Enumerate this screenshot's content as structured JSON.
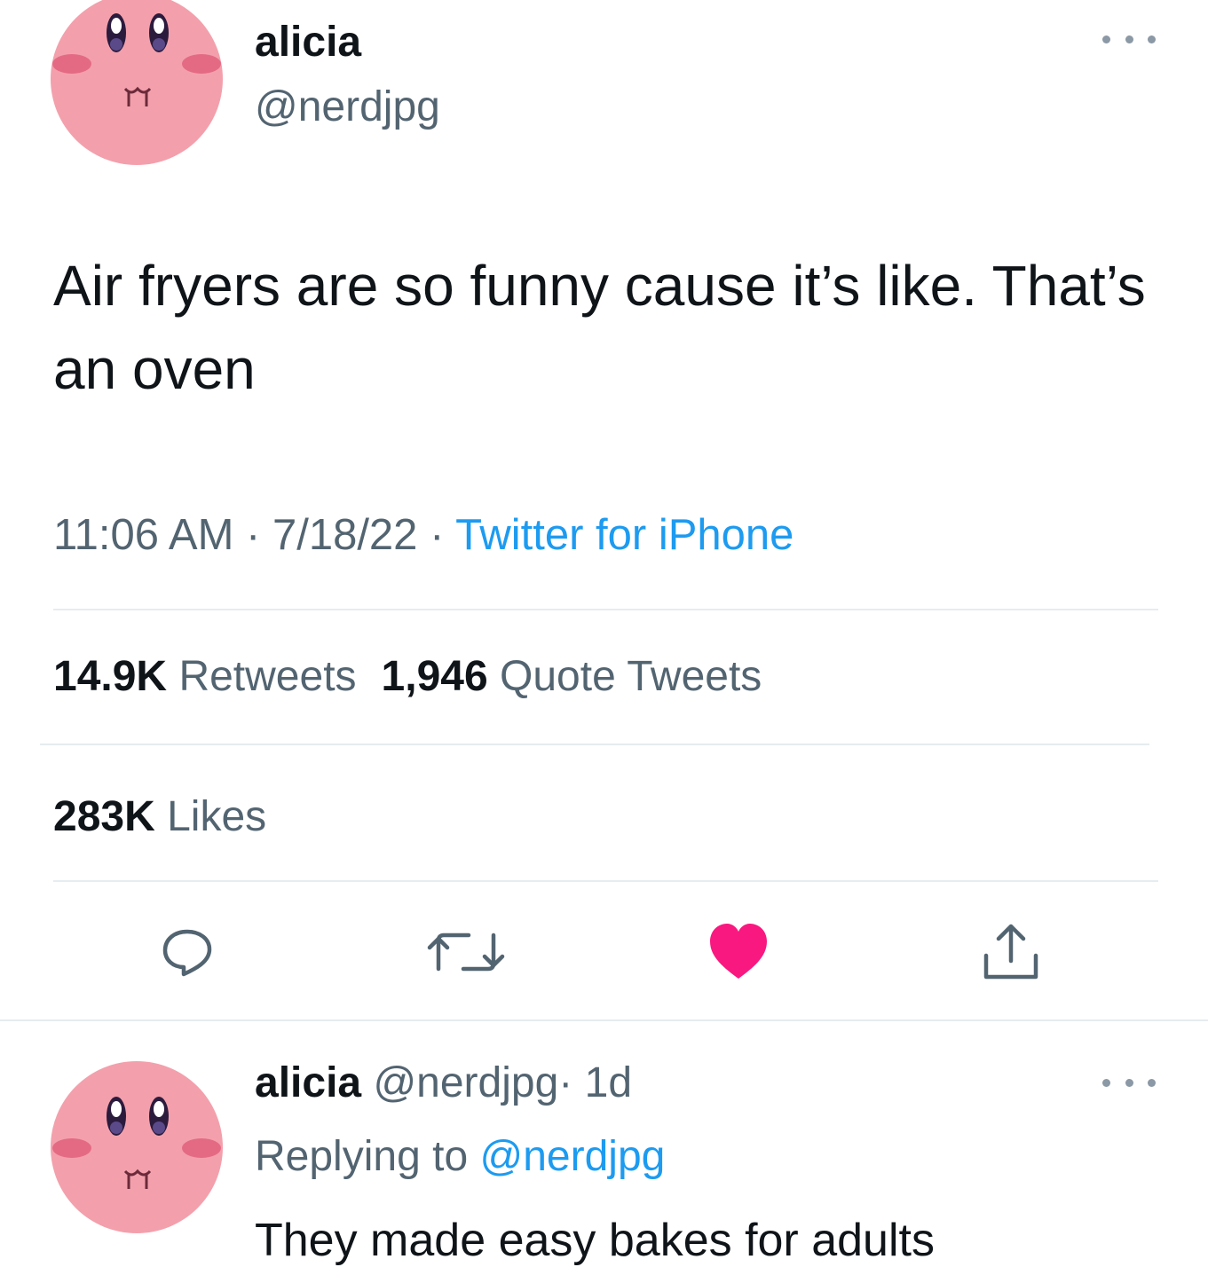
{
  "tweet": {
    "author_name": "alicia",
    "author_handle": "@nerdjpg",
    "text": "Air fryers are so funny cause it’s like. That’s an oven",
    "time": "11:06 AM",
    "date": "7/18/22",
    "separator": " · ",
    "source": "Twitter for iPhone",
    "retweets_count": "14.9K",
    "retweets_label": "Retweets",
    "quotes_count": "1,946",
    "quotes_label": "Quote Tweets",
    "likes_count": "283K",
    "likes_label": "Likes",
    "liked": true
  },
  "icons": {
    "more": "more-horizontal-icon",
    "reply": "reply-bubble-icon",
    "retweet": "retweet-icon",
    "like": "heart-icon",
    "share": "share-icon"
  },
  "reply": {
    "author_name": "alicia",
    "author_handle": "@nerdjpg",
    "age": "· 1d",
    "replying_prefix": "Replying to",
    "replying_to": "@nerdjpg",
    "text": "They made easy bakes for adults"
  },
  "colors": {
    "accent": "#1d9bf0",
    "like": "#f91880",
    "avatar": "#f3a0ac",
    "text": "#0f1419",
    "muted": "#536471"
  }
}
